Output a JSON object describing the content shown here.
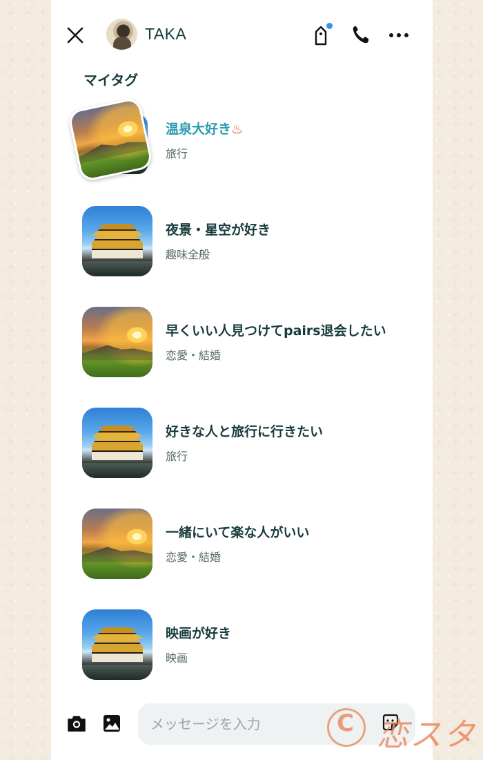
{
  "header": {
    "user_name": "TAKA",
    "icons": [
      "close-icon",
      "tag-icon",
      "phone-icon",
      "more-icon"
    ],
    "notification_dot_color": "#3a95e8"
  },
  "section": {
    "title": "マイタグ"
  },
  "tags": [
    {
      "title": "温泉大好き",
      "title_suffix": "♨",
      "category": "旅行",
      "highlighted": true,
      "image": "sunset-mountain"
    },
    {
      "title": "夜景・星空が好き",
      "category": "趣味全般",
      "highlighted": false,
      "image": "golden-pavilion"
    },
    {
      "title": "早くいい人見つけてpairs退会したい",
      "category": "恋愛・結婚",
      "highlighted": false,
      "image": "sunset-mountain"
    },
    {
      "title": "好きな人と旅行に行きたい",
      "category": "旅行",
      "highlighted": false,
      "image": "golden-pavilion"
    },
    {
      "title": "一緒にいて楽な人がいい",
      "category": "恋愛・結婚",
      "highlighted": false,
      "image": "sunset-mountain"
    },
    {
      "title": "映画が好き",
      "category": "映画",
      "highlighted": false,
      "image": "golden-pavilion"
    }
  ],
  "composer": {
    "placeholder": "メッセージを入力",
    "icons": [
      "camera-icon",
      "image-icon",
      "sticker-icon"
    ]
  },
  "watermark": {
    "circle_letter": "C",
    "text": "恋スタ"
  },
  "colors": {
    "accent": "#2a9bb0",
    "text_primary": "#173b3d",
    "watermark": "#e8845a"
  }
}
